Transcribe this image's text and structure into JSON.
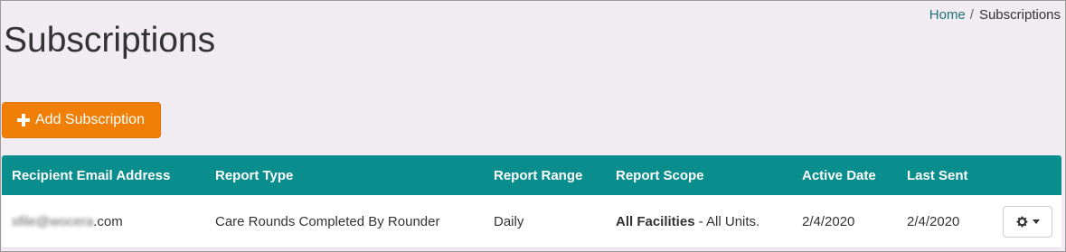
{
  "breadcrumb": {
    "home": "Home",
    "separator": "/",
    "current": "Subscriptions"
  },
  "page": {
    "title": "Subscriptions"
  },
  "actions": {
    "add_label": "Add Subscription"
  },
  "table": {
    "columns": [
      "Recipient Email Address",
      "Report Type",
      "Report Range",
      "Report Scope",
      "Active Date",
      "Last Sent"
    ],
    "rows": [
      {
        "email_blurred": "sfile@wocera",
        "email_domain": ".com",
        "report_type": "Care Rounds Completed By Rounder",
        "report_range": "Daily",
        "scope_bold": "All Facilities",
        "scope_rest": " - All Units.",
        "active_date": "2/4/2020",
        "last_sent": "2/4/2020",
        "actions_icon": "gear-icon"
      }
    ]
  },
  "colors": {
    "accent": "#098d8d",
    "primary_button": "#f07f07",
    "link": "#22727a",
    "background": "#f0ecf2"
  }
}
